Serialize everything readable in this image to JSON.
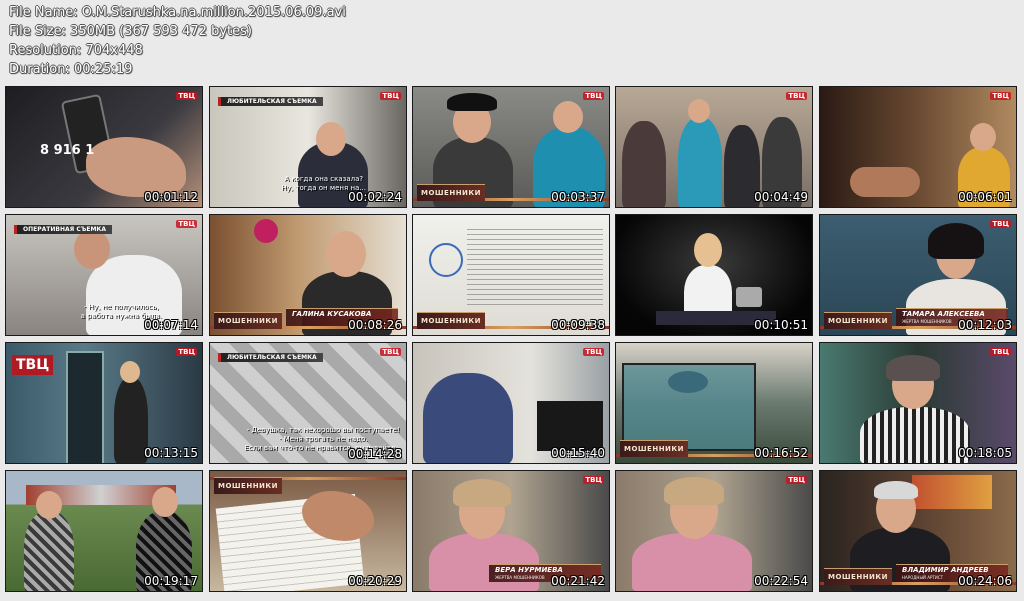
{
  "info": {
    "file_name": "File Name: O.M.Starushka.na.million.2015.06.09.avi",
    "file_size": "File Size: 350MB (367 593 472 bytes)",
    "resolution": "Resolution: 704x448",
    "duration": "Duration: 00:25:19"
  },
  "thumbnails": [
    {
      "time": "00:01:12",
      "overlay": "8 916 1"
    },
    {
      "time": "00:02:24",
      "tag": "ЛЮБИТЕЛЬСКАЯ СЪЕМКА",
      "sub": [
        "А когда она сказала?",
        "Ну, тогда он меня на..."
      ]
    },
    {
      "time": "00:03:37",
      "brand": "МОШЕННИКИ"
    },
    {
      "time": "00:04:49"
    },
    {
      "time": "00:06:01"
    },
    {
      "time": "00:07:14",
      "tag": "ОПЕРАТИВНАЯ СЪЕМКА",
      "sub": [
        "- Ну, не получилось,",
        "а работа нужна была."
      ]
    },
    {
      "time": "00:08:26",
      "name": "ГАЛИНА КУСАКОВА",
      "brand": "МОШЕННИКИ"
    },
    {
      "time": "00:09:38",
      "brand": "МОШЕННИКИ"
    },
    {
      "time": "00:10:51"
    },
    {
      "time": "00:12:03",
      "name": "ТАМАРА АЛЕКСЕЕВА",
      "name_sub": "ЖЕРТВА МОШЕННИКОВ",
      "brand": "МОШЕННИКИ"
    },
    {
      "time": "00:13:15",
      "overlay": "ТВЦ"
    },
    {
      "time": "00:14:28",
      "tag": "ЛЮБИТЕЛЬСКАЯ СЪЕМКА",
      "sub": [
        "- Девушка, так нехорошо вы поступаете!",
        "- Меня трогать не надо.",
        "Если вам что-то не нравится, вызывайте..."
      ]
    },
    {
      "time": "00:15:40"
    },
    {
      "time": "00:16:52",
      "brand": "МОШЕННИКИ"
    },
    {
      "time": "00:18:05"
    },
    {
      "time": "00:19:17"
    },
    {
      "time": "00:20:29",
      "brand": "МОШЕННИКИ"
    },
    {
      "time": "00:21:42",
      "name": "ВЕРА НУРМИЕВА",
      "name_sub": "ЖЕРТВА МОШЕННИКОВ"
    },
    {
      "time": "00:22:54"
    },
    {
      "time": "00:24:06",
      "name": "ВЛАДИМИР АНДРЕЕВ",
      "name_sub": "НАРОДНЫЙ АРТИСТ",
      "brand": "МОШЕННИКИ"
    }
  ],
  "channel_logo": "ТВЦ",
  "colors": {
    "background": "#eaeaea",
    "nameplate": "#6a2e22",
    "accent": "#c8a070"
  }
}
